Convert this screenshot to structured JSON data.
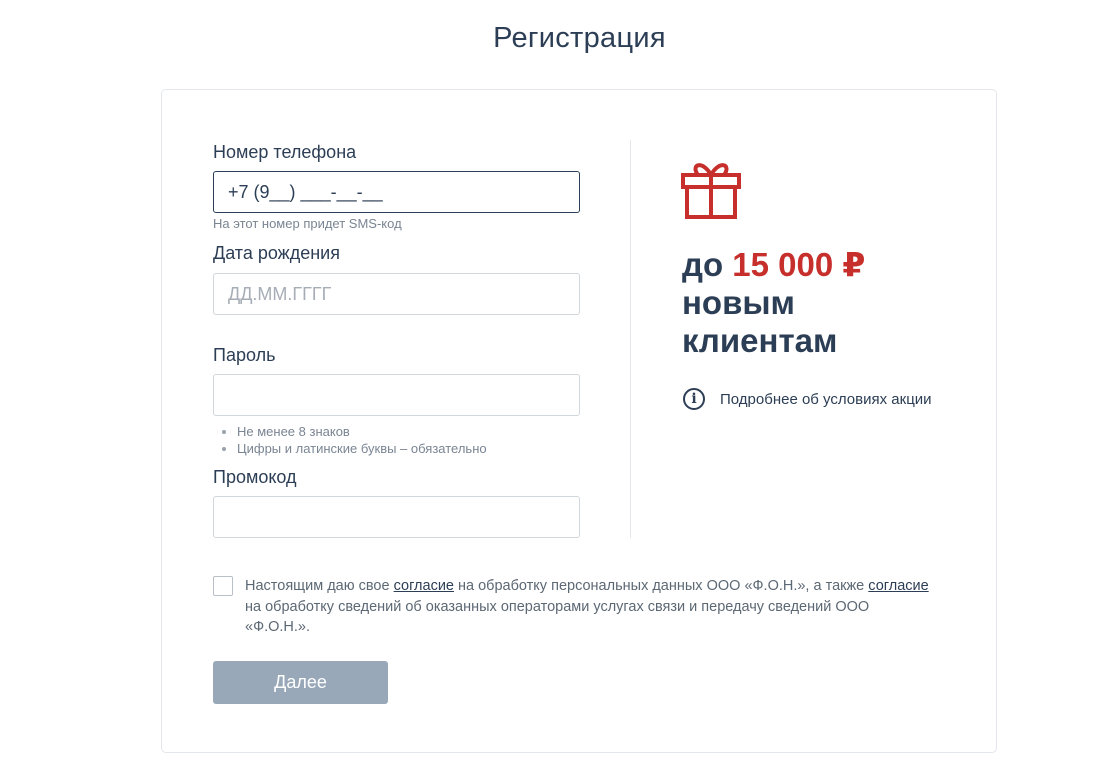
{
  "page": {
    "title": "Регистрация"
  },
  "form": {
    "phone": {
      "label": "Номер телефона",
      "value": "+7 (9__) ___-__-__",
      "hint": "На этот номер придет SMS-код"
    },
    "birthdate": {
      "label": "Дата рождения",
      "placeholder": "ДД.ММ.ГГГГ",
      "value": ""
    },
    "password": {
      "label": "Пароль",
      "value": "",
      "rules": [
        "Не менее 8 знаков",
        "Цифры и латинские буквы – обязательно"
      ]
    },
    "promocode": {
      "label": "Промокод",
      "value": ""
    }
  },
  "promo": {
    "prefix": "до",
    "amount": "15 000 ₽",
    "line2": "новым",
    "line3": "клиентам",
    "details_link": "Подробнее об условиях акции",
    "gift_icon": "gift-icon",
    "info_icon": "info-icon"
  },
  "consent": {
    "checked": false,
    "part1": "Настоящим даю свое",
    "link1": "согласие",
    "part2": "на обработку персональных данных ООО «Ф.О.Н.», а также",
    "link2": "согласие",
    "part3": "на обработку сведений об оказанных операторами услугах связи и передачу сведений ООО «Ф.О.Н.»."
  },
  "actions": {
    "next_label": "Далее"
  },
  "colors": {
    "text": "#2c3e55",
    "accent": "#c62f2b",
    "button_disabled": "#98a8b9",
    "border": "#d2d7dd"
  }
}
